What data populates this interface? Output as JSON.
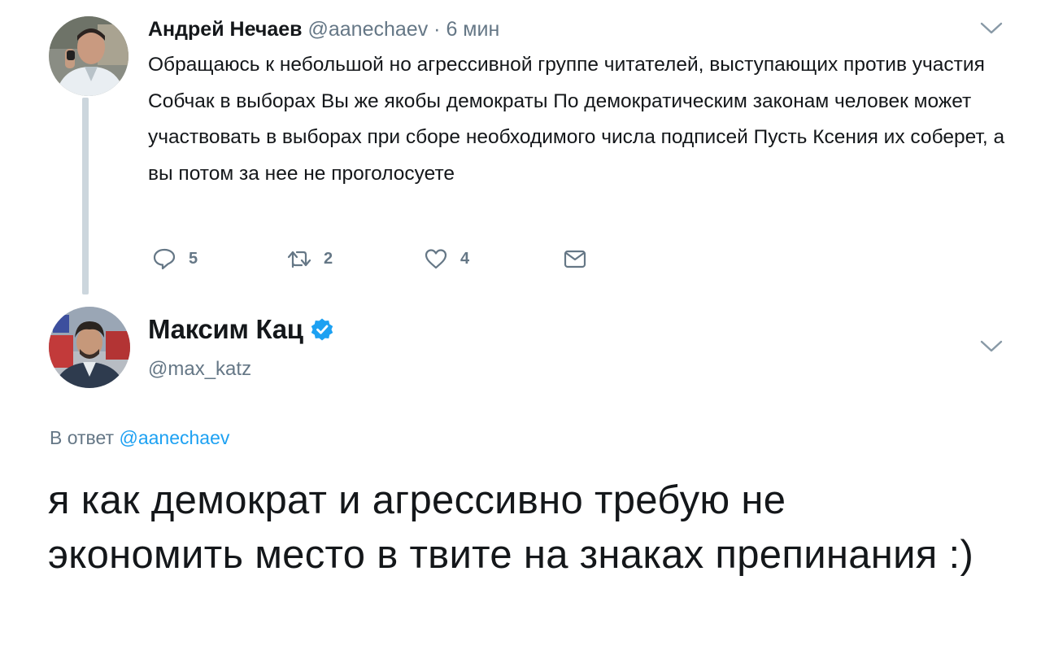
{
  "parent_tweet": {
    "author_name": "Андрей Нечаев",
    "handle": "@aanechaev",
    "separator": "·",
    "time": "6 мин",
    "text": "Обращаюсь к небольшой но агрессивной группе читателей, выступающих против участия Собчак в выборах Вы же якобы демократы По демократическим законам человек может участвовать в выборах при сборе необходимого числа подписей Пусть Ксения их соберет, а вы потом за нее не проголосуете",
    "actions": {
      "reply_count": "5",
      "retweet_count": "2",
      "like_count": "4"
    },
    "icons": [
      "reply-icon",
      "retweet-icon",
      "like-icon",
      "envelope-icon",
      "chevron-down-icon"
    ]
  },
  "main_tweet": {
    "author_name": "Максим Кац",
    "verified": true,
    "handle": "@max_katz",
    "reply_prefix": "В ответ",
    "reply_handle": "@aanechaev",
    "text": "я как демократ и агрессивно требую не экономить место в твите на знаках препинания :)"
  },
  "colors": {
    "text": "#14171a",
    "secondary": "#657786",
    "link": "#1da1f2",
    "thread_line": "#ccd6dd",
    "verified_badge": "#1da1f2"
  }
}
